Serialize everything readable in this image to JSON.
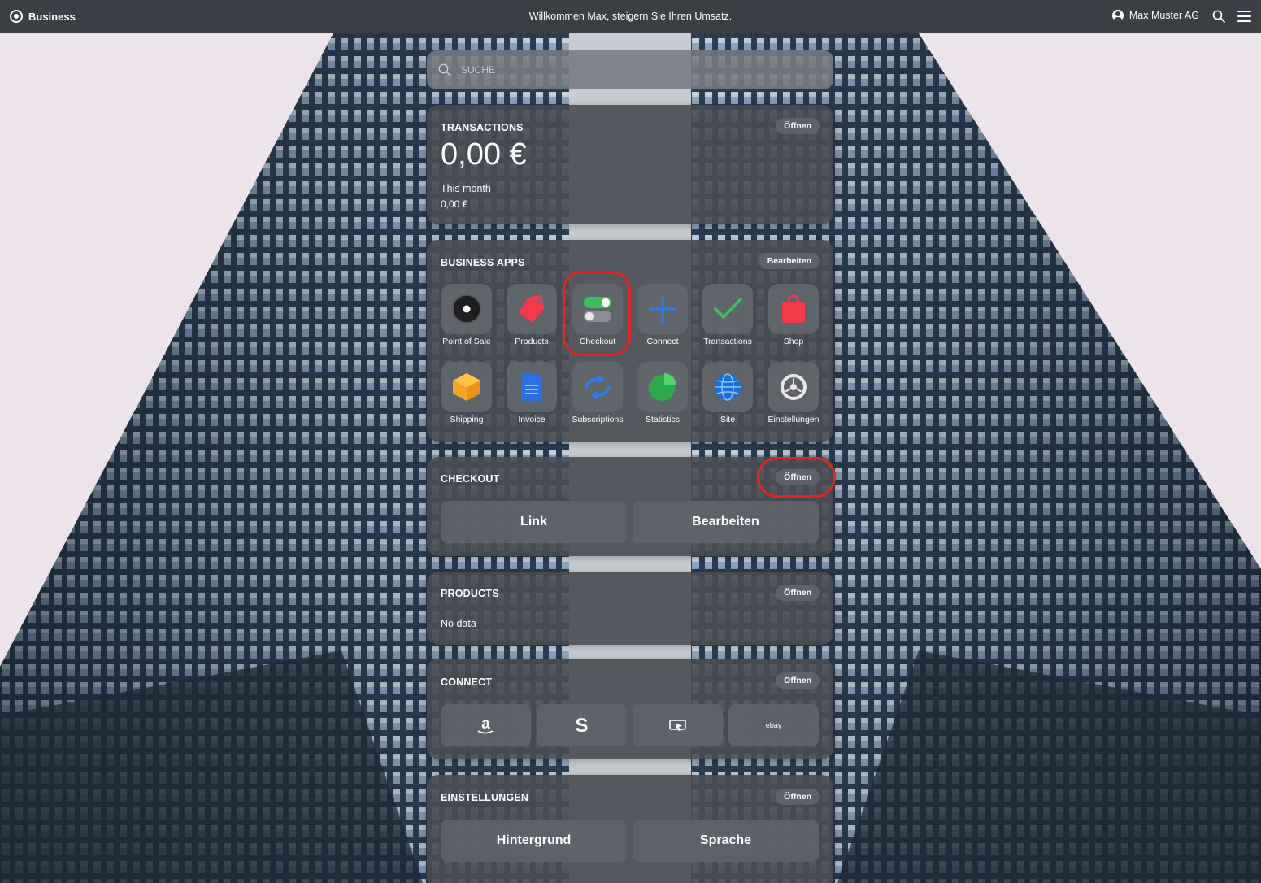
{
  "topbar": {
    "brand": "Business",
    "welcome": "Willkommen Max, steigern Sie Ihren Umsatz.",
    "account": "Max Muster AG",
    "account_icon": "user-circle-icon",
    "search_icon": "search-icon",
    "menu_icon": "hamburger-menu-icon"
  },
  "search": {
    "placeholder": "SUCHE"
  },
  "transactions": {
    "title": "TRANSACTIONS",
    "open_label": "Öffnen",
    "amount": "0,00 €",
    "period_label": "This month",
    "period_amount": "0,00 €"
  },
  "business_apps": {
    "title": "BUSINESS APPS",
    "edit_label": "Bearbeiten",
    "apps": [
      {
        "label": "Point of Sale",
        "icon": "point-of-sale-icon"
      },
      {
        "label": "Products",
        "icon": "price-tag-icon"
      },
      {
        "label": "Checkout",
        "icon": "toggle-icon"
      },
      {
        "label": "Connect",
        "icon": "plus-icon"
      },
      {
        "label": "Transactions",
        "icon": "checkmark-icon"
      },
      {
        "label": "Shop",
        "icon": "shopping-bag-icon"
      },
      {
        "label": "Shipping",
        "icon": "box-icon"
      },
      {
        "label": "Invoice",
        "icon": "document-icon"
      },
      {
        "label": "Subscriptions",
        "icon": "refresh-arrows-icon"
      },
      {
        "label": "Statistics",
        "icon": "pie-chart-icon"
      },
      {
        "label": "Site",
        "icon": "globe-icon"
      },
      {
        "label": "Einstellungen",
        "icon": "settings-gear-icon"
      }
    ]
  },
  "checkout": {
    "title": "CHECKOUT",
    "open_label": "Öffnen",
    "link_label": "Link",
    "edit_label": "Bearbeiten"
  },
  "products": {
    "title": "PRODUCTS",
    "open_label": "Öffnen",
    "empty_text": "No data"
  },
  "connect": {
    "title": "CONNECT",
    "open_label": "Öffnen",
    "services": [
      {
        "icon": "amazon-icon"
      },
      {
        "icon": "s-logo-icon"
      },
      {
        "icon": "screen-cursor-icon"
      },
      {
        "icon": "ebay-icon",
        "label": "ebay"
      }
    ]
  },
  "settings": {
    "title": "EINSTELLUNGEN",
    "open_label": "Öffnen",
    "background_label": "Hintergrund",
    "language_label": "Sprache"
  },
  "colors": {
    "topbar": "#3b3e44",
    "card": "#484b52",
    "highlight_ring": "#e0261e",
    "sky": "#e9e2e8"
  }
}
